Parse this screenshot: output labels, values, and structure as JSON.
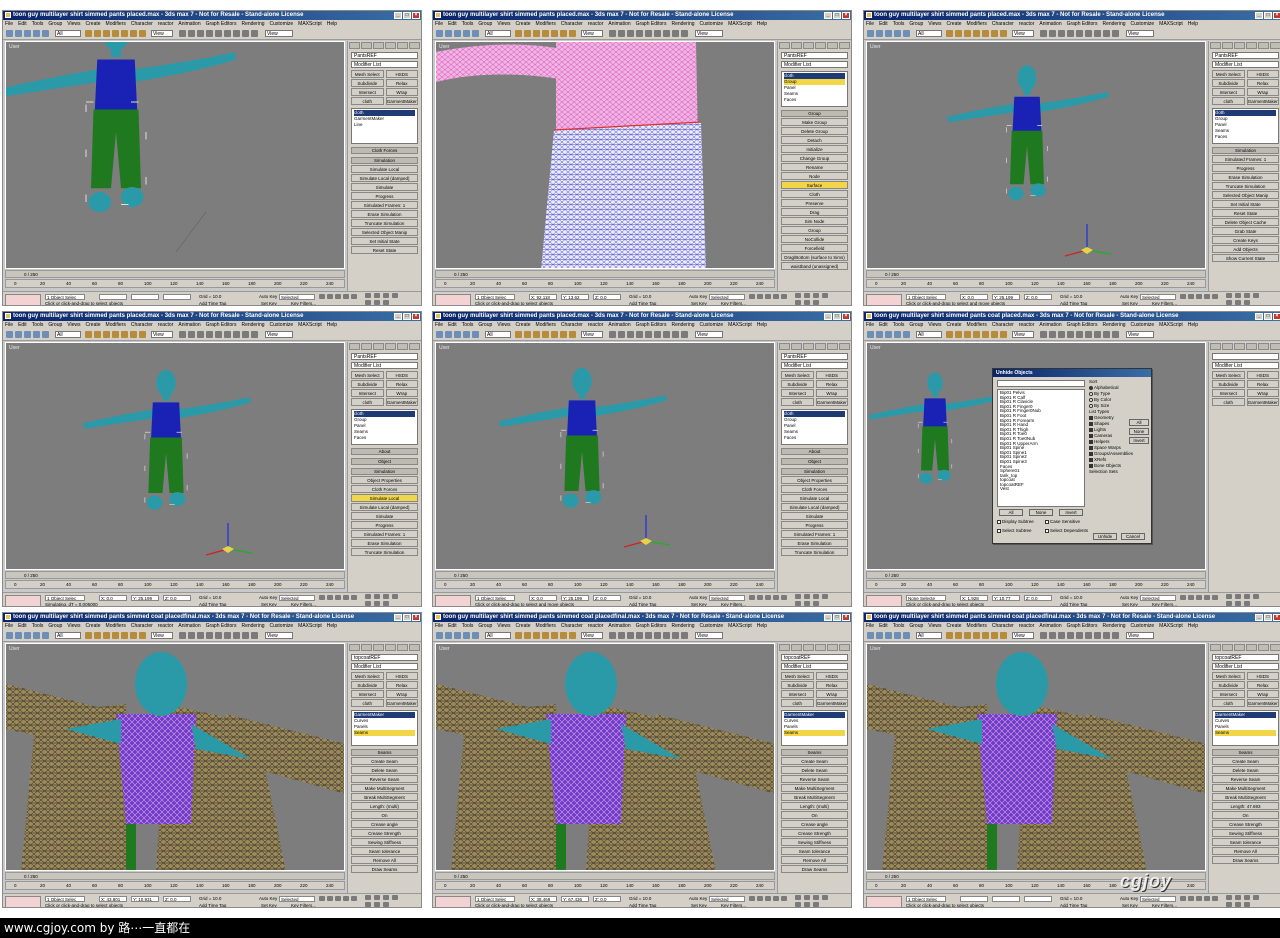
{
  "caption": "www.cgjoy.com by 路⋯一直都在",
  "watermark": "cgjoy",
  "menu_items": [
    "File",
    "Edit",
    "Tools",
    "Group",
    "Views",
    "Create",
    "Modifiers",
    "Character",
    "reactor",
    "Animation",
    "Graph Editors",
    "Rendering",
    "Customize",
    "MAXScript",
    "Help"
  ],
  "toolbar": {
    "select_filter": "All",
    "view": "View"
  },
  "viewport_label": "User",
  "timeline": {
    "frame": "0 / 250"
  },
  "track_ticks": [
    "0",
    "20",
    "40",
    "60",
    "80",
    "100",
    "120",
    "140",
    "160",
    "180",
    "200",
    "220",
    "240"
  ],
  "status": {
    "auto_key": "Auto Key",
    "selected": "Selected",
    "set_key": "Set Key",
    "key_filters": "Key Filters...",
    "add_time_tag": "Add Time Tag",
    "grid": "Grid = 10.0"
  },
  "panels": [
    {
      "title": "toon guy multilayer shirt simmed pants placed.max - 3ds max 7 - Not for Resale - Stand-alone License",
      "object": "PantsREF",
      "modifier_list": "Modifier List",
      "buttons": [
        [
          "Mesh Select",
          "HSDS"
        ],
        [
          "Subdivide",
          "Relax"
        ],
        [
          "Intersect",
          "Wrap"
        ],
        [
          "cloth",
          "GarmentMaker"
        ]
      ],
      "stack": [
        {
          "label": "cloth",
          "state": "head"
        },
        {
          "label": "GarmentMaker",
          "state": ""
        },
        {
          "label": "Line",
          "state": ""
        }
      ],
      "sections": [
        "Cloth Forces",
        "Simulation"
      ],
      "labels": [
        "Simulate Local",
        "Simulate Local (damped)",
        "Simulate",
        "Progress",
        "Simulated Frames: 1",
        "Erase Simulation",
        "Truncate Simulation",
        "Selected Object Manip",
        "Set Initial State",
        "Reset State"
      ],
      "status_left": "1 Object Selec",
      "status_msg": "Click or click-and-drag to select objects",
      "coords": [
        "",
        "",
        ""
      ]
    },
    {
      "title": "toon guy multilayer shirt simmed pants placed.max - 3ds max 7 - Not for Resale - Stand-alone License",
      "object": "PantsREF",
      "modifier_list": "Modifier List",
      "buttons": [],
      "stack": [
        {
          "label": "cloth",
          "state": "head"
        },
        {
          "label": "Group",
          "state": "sel"
        },
        {
          "label": "Panel",
          "state": ""
        },
        {
          "label": "Seams",
          "state": ""
        },
        {
          "label": "Faces",
          "state": ""
        }
      ],
      "sections": [
        "Group"
      ],
      "labels": [
        "Make Group",
        "Delete Group",
        "Detach",
        "Initialize",
        "Change Group",
        "Rename",
        "Node",
        "Surface",
        "Cloth",
        "Preserve",
        "Drag",
        "Sim Node",
        "Group",
        "NoCollide",
        "Forcefield",
        "Drag/Bottom (surface to Sims)",
        "waistband (unassigned)"
      ],
      "status_left": "1 Object Selec",
      "status_msg": "Click or click-and-drag to select objects",
      "coords": [
        "X: 92.118",
        "Y: 13.62",
        "Z: 0.0"
      ]
    },
    {
      "title": "toon guy multilayer shirt simmed pants placed.max - 3ds max 7 - Not for Resale - Stand-alone License",
      "object": "PantsREF",
      "modifier_list": "Modifier List",
      "buttons": [
        [
          "Mesh Select",
          "HSDS"
        ],
        [
          "Subdivide",
          "Relax"
        ],
        [
          "Intersect",
          "Wrap"
        ],
        [
          "cloth",
          "GarmentMaker"
        ]
      ],
      "stack": [
        {
          "label": "cloth",
          "state": "head"
        },
        {
          "label": "Group",
          "state": ""
        },
        {
          "label": "Panel",
          "state": ""
        },
        {
          "label": "Seams",
          "state": ""
        },
        {
          "label": "Faces",
          "state": ""
        }
      ],
      "sections": [
        "Simulation"
      ],
      "labels": [
        "Simulated Frames: 1",
        "Progress",
        "Erase Simulation",
        "Truncate Simulation",
        "Selected Object Manip",
        "Set Initial State",
        "Reset State",
        "Delete Object Cache",
        "Grab State",
        "Create Keys",
        "Add Objects",
        "Show Current State"
      ],
      "status_left": "1 Object Selec",
      "status_msg": "Click or click-and-drag to select and move objects",
      "coords": [
        "X: 0.0",
        "Y: 25.199",
        "Z: 0.0"
      ]
    },
    {
      "title": "toon guy multilayer shirt simmed pants placed.max - 3ds max 7 - Not for Resale - Stand-alone License",
      "object": "PantsREF",
      "modifier_list": "Modifier List",
      "buttons": [
        [
          "Mesh Select",
          "HSDS"
        ],
        [
          "Subdivide",
          "Relax"
        ],
        [
          "Intersect",
          "Wrap"
        ],
        [
          "cloth",
          "GarmentMaker"
        ]
      ],
      "stack": [
        {
          "label": "cloth",
          "state": "head"
        },
        {
          "label": "Group",
          "state": ""
        },
        {
          "label": "Panel",
          "state": ""
        },
        {
          "label": "Seams",
          "state": ""
        },
        {
          "label": "Faces",
          "state": ""
        }
      ],
      "sections": [
        "About",
        "Object",
        "Simulation"
      ],
      "labels": [
        "Object Properties",
        "Cloth Forces",
        "Simulate Local",
        "Simulate Local (damped)",
        "Simulate",
        "Progress",
        "Simulated Frames: 1",
        "Erase Simulation",
        "Truncate Simulation"
      ],
      "status_left": "1 Object Selec",
      "status_msg": "Simulating, dT = 0.005000",
      "coords": [
        "X: 0.0",
        "Y: 25.199",
        "Z: 0.0"
      ]
    },
    {
      "title": "toon guy multilayer shirt simmed pants placed.max - 3ds max 7 - Not for Resale - Stand-alone License",
      "object": "PantsREF",
      "modifier_list": "Modifier List",
      "buttons": [
        [
          "Mesh Select",
          "HSDS"
        ],
        [
          "Subdivide",
          "Relax"
        ],
        [
          "Intersect",
          "Wrap"
        ],
        [
          "cloth",
          "GarmentMaker"
        ]
      ],
      "stack": [
        {
          "label": "cloth",
          "state": "head"
        },
        {
          "label": "Group",
          "state": ""
        },
        {
          "label": "Panel",
          "state": ""
        },
        {
          "label": "Seams",
          "state": ""
        },
        {
          "label": "Faces",
          "state": ""
        }
      ],
      "sections": [
        "About",
        "Object",
        "Simulation"
      ],
      "labels": [
        "Object Properties",
        "Cloth Forces",
        "Simulate Local",
        "Simulate Local (damped)",
        "Simulate",
        "Progress",
        "Simulated Frames: 1",
        "Erase Simulation",
        "Truncate Simulation"
      ],
      "status_left": "1 Object Selec",
      "status_msg": "Click or click-and-drag to select and move objects",
      "coords": [
        "X: 0.0",
        "Y: 25.199",
        "Z: 0.0"
      ]
    },
    {
      "title": "toon guy multilayer shirt simmed pants coat placed.max - 3ds max 7 - Not for Resale - Stand-alone License",
      "object": "",
      "modifier_list": "Modifier List",
      "buttons": [
        [
          "Mesh Select",
          "HSDS"
        ],
        [
          "Subdivide",
          "Relax"
        ],
        [
          "Intersect",
          "Wrap"
        ],
        [
          "cloth",
          "GarmentMaker"
        ]
      ],
      "stack": [],
      "sections": [],
      "labels": [],
      "status_left": "None Selecte",
      "status_msg": "Click or click-and-drag to select objects",
      "coords": [
        "X: 1.928",
        "Y: 10.77",
        "Z: 0.0"
      ],
      "dialog": {
        "title": "Unhide Objects",
        "list": [
          "Bip01 Pelvis",
          "Bip01 R Calf",
          "Bip01 R Clavicle",
          "Bip01 R Finger0",
          "Bip01 R Finger0Nub",
          "Bip01 R Foot",
          "Bip01 R Forearm",
          "Bip01 R Hand",
          "Bip01 R Thigh",
          "Bip01 R Toe0",
          "Bip01 R Toe0Nub",
          "Bip01 R UpperArm",
          "Bip01 Spine",
          "Bip01 Spine1",
          "Bip01 Spine2",
          "Bip01 Spine3",
          "Faces",
          "Sphere01",
          "tank_top",
          "topcoat",
          "topcoatREF",
          "Vest"
        ],
        "sort_label": "Sort",
        "sort_options": [
          "Alphabetical",
          "By Type",
          "By Color",
          "By Size"
        ],
        "list_types_label": "List Types",
        "list_types": [
          "Geometry",
          "Shapes",
          "Lights",
          "Cameras",
          "Helpers",
          "Space Warps",
          "Groups/Assemblies",
          "XRefs",
          "Bone Objects"
        ],
        "type_buttons": [
          "All",
          "None",
          "Invert"
        ],
        "selection_sets": "Selection Sets",
        "bottom_buttons": [
          "All",
          "None",
          "Invert"
        ],
        "checks": [
          "Display Subtree",
          "Case Sensitive",
          "Select Subtree",
          "Select Dependents"
        ],
        "actions": [
          "Unhide",
          "Cancel"
        ]
      }
    },
    {
      "title": "toon guy multilayer shirt simmed pants simmed coat placedfinal.max - 3ds max 7 - Not for Resale - Stand-alone License",
      "object": "topcoatREF",
      "modifier_list": "Modifier List",
      "buttons": [
        [
          "Mesh Select",
          "HSDS"
        ],
        [
          "Subdivide",
          "Relax"
        ],
        [
          "Intersect",
          "Wrap"
        ],
        [
          "cloth",
          "GarmentMaker"
        ]
      ],
      "stack": [
        {
          "label": "GarmentMaker",
          "state": "head"
        },
        {
          "label": "Curves",
          "state": ""
        },
        {
          "label": "Panels",
          "state": ""
        },
        {
          "label": "Seams",
          "state": "sel"
        }
      ],
      "sections": [
        "Seams"
      ],
      "labels": [
        "Create Seam",
        "Delete Seam",
        "Reverse Seam",
        "Make MultiSegment",
        "Break MultiSegment",
        "Length: (multi)",
        "On",
        "Crease angle",
        "Crease Strength",
        "Sewing Stiffness",
        "Seam tolerance",
        "Remove All",
        "Draw Seams"
      ],
      "status_left": "1 Object Selec",
      "status_msg": "Click or click-and-drag to select objects",
      "coords": [
        "X: 43.801",
        "Y: 10.931",
        "Z: 0.0"
      ]
    },
    {
      "title": "toon guy multilayer shirt simmed pants simmed coat placedfinal.max - 3ds max 7 - Not for Resale - Stand-alone License",
      "object": "topcoatREF",
      "modifier_list": "Modifier List",
      "buttons": [
        [
          "Mesh Select",
          "HSDS"
        ],
        [
          "Subdivide",
          "Relax"
        ],
        [
          "Intersect",
          "Wrap"
        ],
        [
          "cloth",
          "GarmentMaker"
        ]
      ],
      "stack": [
        {
          "label": "GarmentMaker",
          "state": "head"
        },
        {
          "label": "Curves",
          "state": ""
        },
        {
          "label": "Panels",
          "state": ""
        },
        {
          "label": "Seams",
          "state": "sel"
        }
      ],
      "sections": [
        "Seams"
      ],
      "labels": [
        "Create Seam",
        "Delete Seam",
        "Reverse Seam",
        "Make MultiSegment",
        "Break MultiSegment",
        "Length: (multi)",
        "On",
        "Crease angle",
        "Crease Strength",
        "Sewing Stiffness",
        "Seam tolerance",
        "Remove All",
        "Draw Seams"
      ],
      "status_left": "1 Object Selec",
      "status_msg": "Click or click-and-drag to select objects",
      "coords": [
        "X: 38.469",
        "Y: 67.436",
        "Z: 0.0"
      ]
    },
    {
      "title": "toon guy multilayer shirt simmed pants simmed coat placedfinal.max - 3ds max 7 - Not for Resale - Stand-alone License",
      "object": "topcoatREF",
      "modifier_list": "Modifier List",
      "buttons": [
        [
          "Mesh Select",
          "HSDS"
        ],
        [
          "Subdivide",
          "Relax"
        ],
        [
          "Intersect",
          "Wrap"
        ],
        [
          "cloth",
          "GarmentMaker"
        ]
      ],
      "stack": [
        {
          "label": "GarmentMaker",
          "state": "head"
        },
        {
          "label": "Curves",
          "state": ""
        },
        {
          "label": "Panels",
          "state": ""
        },
        {
          "label": "Seams",
          "state": "sel"
        }
      ],
      "sections": [
        "Seams"
      ],
      "labels": [
        "Create Seam",
        "Delete Seam",
        "Reverse Seam",
        "Make MultiSegment",
        "Break MultiSegment",
        "Length: 47.693",
        "On",
        "Crease Strength",
        "Sewing Stiffness",
        "Seam tolerance",
        "Remove All",
        "Draw Seams"
      ],
      "status_left": "1 Object Selec",
      "status_msg": "Click or click-and-drag to select objects",
      "coords": [
        "",
        "",
        ""
      ]
    }
  ],
  "colors": {
    "skin": "#2a9aa8",
    "shirt": "#1a22b5",
    "pants": "#1f7a1f",
    "viewport": "#7d7d7d",
    "ui_gray": "#d4d0c8",
    "selection": "#f2d64a",
    "coat_mesh": "#9c8a5a",
    "seam_pink": "#c060e0"
  }
}
